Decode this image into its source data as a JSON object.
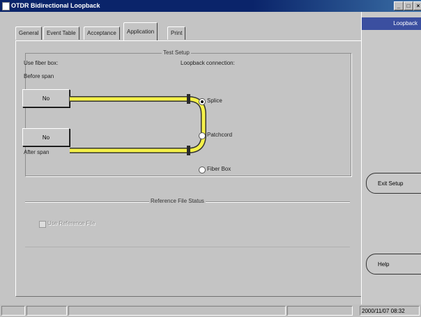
{
  "window": {
    "title": "OTDR Bidirectional Loopback"
  },
  "tabs": [
    {
      "label": "General",
      "active": false
    },
    {
      "label": "Event Table",
      "active": false
    },
    {
      "label": "Acceptance",
      "active": false
    },
    {
      "label": "Application",
      "active": true
    },
    {
      "label": "Print",
      "active": false
    }
  ],
  "test_setup": {
    "title": "Test Setup",
    "use_fiber_box_label": "Use fiber box:",
    "before_span_label": "Before span",
    "after_span_label": "After span",
    "before_span_button": "No",
    "after_span_button": "No",
    "loopback_label": "Loopback connection:",
    "options": [
      {
        "label": "Splice",
        "selected": true
      },
      {
        "label": "Patchcord",
        "selected": false
      },
      {
        "label": "Fiber Box",
        "selected": false
      }
    ],
    "fiber_color": "#f4f048"
  },
  "reference": {
    "title": "Reference File Status",
    "checkbox_label": "Use Reference File",
    "checkbox_checked": false,
    "enabled": false
  },
  "sidebar": {
    "header": "Loopback",
    "exit_setup_button": "Exit Setup",
    "help_button": "Help"
  },
  "status_bar": {
    "timestamp": "2000/11/07 08:32"
  }
}
